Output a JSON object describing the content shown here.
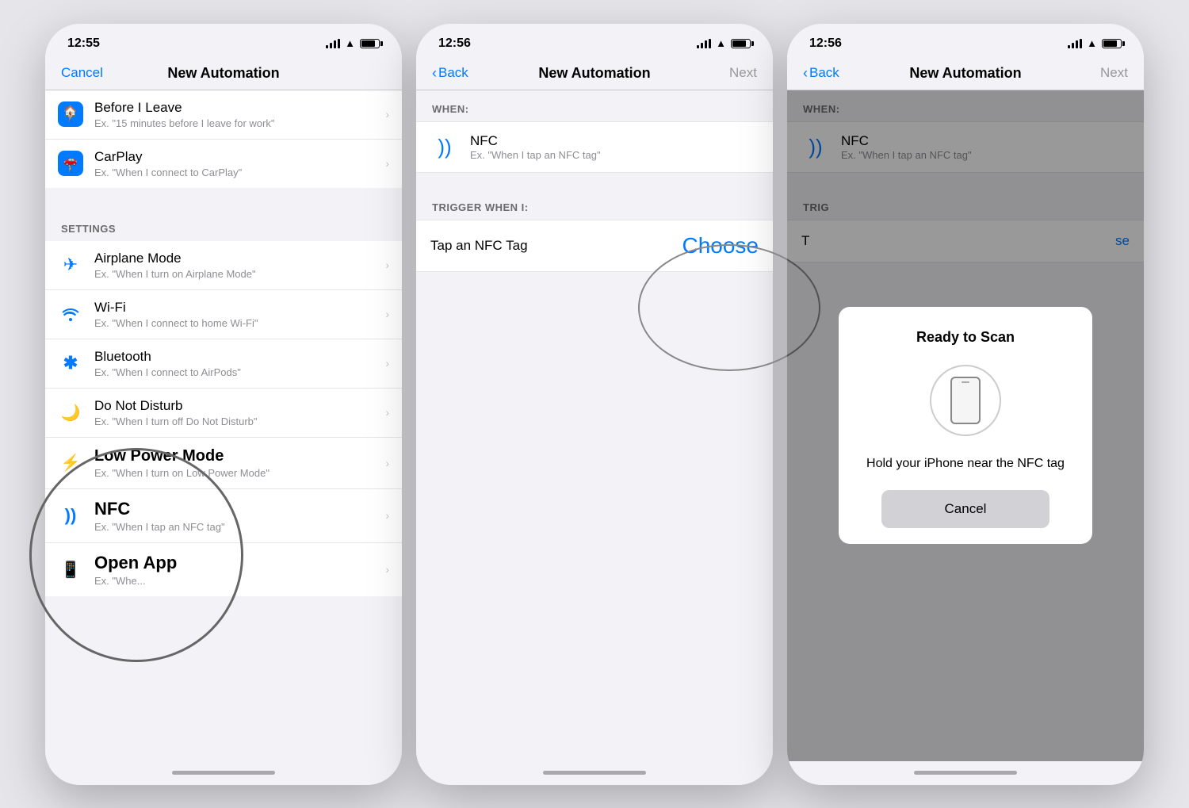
{
  "phone1": {
    "statusBar": {
      "time": "12:55"
    },
    "nav": {
      "cancelLabel": "Cancel",
      "title": "New Automation"
    },
    "topItems": [
      {
        "icon": "🏠",
        "title": "Before I Leave",
        "subtitle": "Ex. \"15 minutes before I leave for work\""
      },
      {
        "icon": "🚗",
        "title": "CarPlay",
        "subtitle": "Ex. \"When I connect to CarPlay\""
      }
    ],
    "settingsHeader": "SETTINGS",
    "settingsItems": [
      {
        "icon": "✈",
        "title": "Airplane Mode",
        "subtitle": "Ex. \"When I turn on Airplane Mode\""
      },
      {
        "icon": "📶",
        "title": "Wi-Fi",
        "subtitle": "Ex. \"When I connect to home Wi-Fi\""
      },
      {
        "icon": "✱",
        "title": "Bluetooth",
        "subtitle": "Ex. \"When I connect to AirPods\""
      },
      {
        "icon": "🌙",
        "title": "Do Not Disturb",
        "subtitle": "Ex. \"When I turn off Do Not Disturb\""
      },
      {
        "icon": "⚡",
        "title": "Low Power Mode",
        "subtitle": "Ex. \"When I turn on Low Power Mode\""
      },
      {
        "icon": "))",
        "title": "NFC",
        "subtitle": "Ex. \"When I tap an NFC tag\""
      },
      {
        "icon": "📱",
        "title": "Open App",
        "subtitle": "Ex. \"Whe..."
      }
    ]
  },
  "phone2": {
    "statusBar": {
      "time": "12:56"
    },
    "nav": {
      "backLabel": "Back",
      "title": "New Automation",
      "nextLabel": "Next"
    },
    "whenLabel": "WHEN:",
    "nfc": {
      "title": "NFC",
      "subtitle": "Ex. \"When I tap an NFC tag\""
    },
    "triggerLabel": "TRIGGER WHEN I:",
    "triggerText": "Tap an NFC Tag",
    "chooseLabel": "Choose"
  },
  "phone3": {
    "statusBar": {
      "time": "12:56"
    },
    "nav": {
      "backLabel": "Back",
      "title": "New Automation",
      "nextLabel": "Next"
    },
    "whenLabel": "WHEN:",
    "nfc": {
      "title": "NFC",
      "subtitle": "Ex. \"When I tap an NFC tag\""
    },
    "triggerLabel": "TRIG",
    "triggerText": "T",
    "chooseShort": "se",
    "modal": {
      "title": "Ready to Scan",
      "description": "Hold your iPhone near the NFC tag",
      "cancelLabel": "Cancel"
    }
  }
}
